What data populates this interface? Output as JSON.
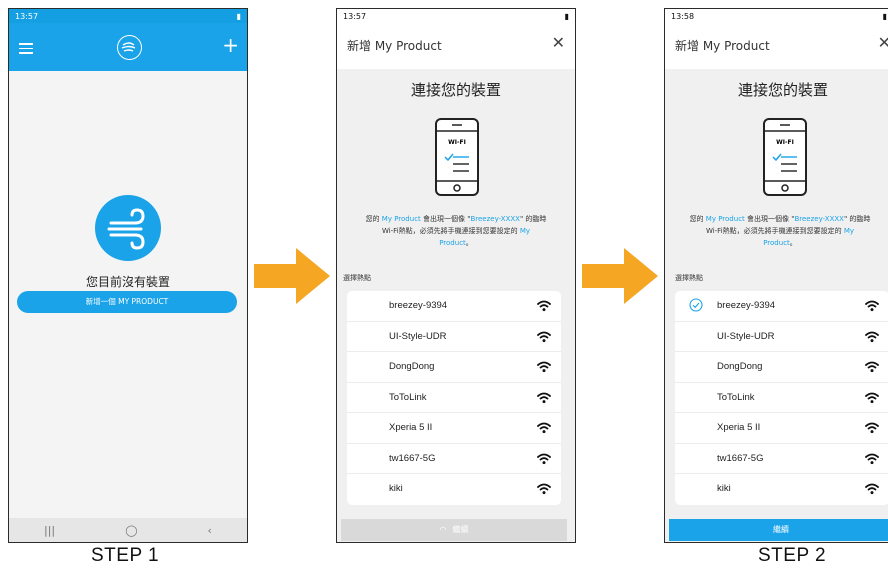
{
  "step1": {
    "status_time": "13:57",
    "add_button_label": "新增一個 MY PRODUCT",
    "no_device_text": "您目前沒有裝置",
    "nav": {
      "recents": "|||",
      "home": "◯",
      "back": "‹"
    },
    "step_label": "STEP 1"
  },
  "step2": {
    "status_time": "13:57",
    "dialog_title": "新增 My Product",
    "close_glyph": "✕",
    "connect_title": "連接您的裝置",
    "wifi_art_label": "WI-FI",
    "desc": {
      "part1": "您的 ",
      "product1": "My Product",
      "part2": " 會出現一個像 \"",
      "ssid": "Breezey-XXXX",
      "part3": "\" 的臨時",
      "line2": "Wi-Fi熱點，必須先將手機連接到您要設定的 ",
      "product2": "My",
      "line3_hl": "Product",
      "line3_end": "。"
    },
    "hotspot_label": "選擇熱點",
    "networks": [
      "breezey-9394",
      "UI-Style-UDR",
      "DongDong",
      "ToToLink",
      "Xperia 5 II",
      "tw1667-5G",
      "kiki"
    ],
    "continue_label": "繼續",
    "continue_spinner": "◠"
  },
  "step3": {
    "status_time": "13:58",
    "dialog_title": "新增 My Product",
    "close_glyph": "✕",
    "connect_title": "連接您的裝置",
    "wifi_art_label": "WI-FI",
    "desc": {
      "part1": "您的 ",
      "product1": "My Product",
      "part2": " 會出現一個像 \"",
      "ssid": "Breezey-XXXX",
      "part3": "\" 的臨時",
      "line2": "Wi-Fi熱點，必須先將手機連接到您要設定的 ",
      "product2": "My",
      "line3_hl": "Product",
      "line3_end": "。"
    },
    "hotspot_label": "選擇熱點",
    "networks": [
      "breezey-9394",
      "UI-Style-UDR",
      "DongDong",
      "ToToLink",
      "Xperia 5 II",
      "tw1667-5G",
      "kiki"
    ],
    "selected_network": "breezey-9394",
    "continue_label": "繼續",
    "step_label": "STEP 2"
  },
  "colors": {
    "accent": "#1aa3e8",
    "arrow": "#f5a623",
    "disabled_button": "#d9d9d9"
  }
}
